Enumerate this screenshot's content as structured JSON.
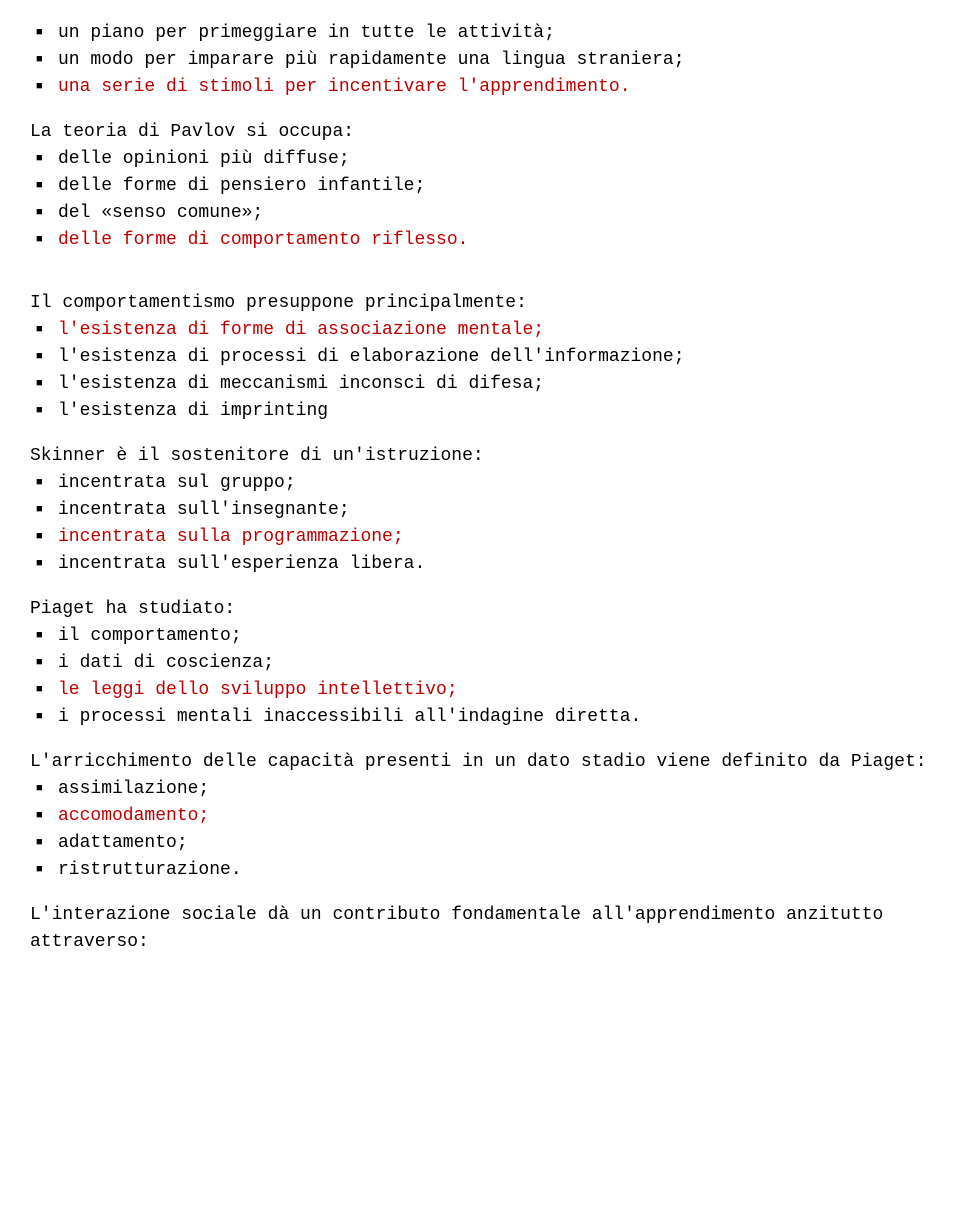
{
  "questions": [
    {
      "text": "",
      "options": [
        {
          "label": "un piano per primeggiare in tutte le attività;",
          "highlight": false
        },
        {
          "label": "un modo per imparare più rapidamente una lingua straniera;",
          "highlight": false
        },
        {
          "label": "una serie di stimoli per incentivare l'apprendimento.",
          "highlight": true
        }
      ]
    },
    {
      "text": "La teoria di Pavlov si occupa:",
      "options": [
        {
          "label": "delle opinioni più diffuse;",
          "highlight": false
        },
        {
          "label": "delle forme di pensiero infantile;",
          "highlight": false
        },
        {
          "label": "del «senso comune»;",
          "highlight": false
        },
        {
          "label": "delle forme di comportamento riflesso.",
          "highlight": true
        }
      ],
      "extraGap": true
    },
    {
      "text": "Il comportamentismo presuppone principalmente:",
      "options": [
        {
          "label": "l'esistenza di forme di associazione mentale;",
          "highlight": true
        },
        {
          "label": "l'esistenza di processi di elaborazione dell'informazione;",
          "highlight": false
        },
        {
          "label": "l'esistenza di meccanismi inconsci di difesa;",
          "highlight": false
        },
        {
          "label": "l'esistenza di imprinting",
          "highlight": false
        }
      ]
    },
    {
      "text": "Skinner è il sostenitore di un'istruzione:",
      "options": [
        {
          "label": "incentrata sul gruppo;",
          "highlight": false
        },
        {
          "label": "incentrata sull'insegnante;",
          "highlight": false
        },
        {
          "label": "incentrata sulla programmazione;",
          "highlight": true
        },
        {
          "label": "incentrata sull'esperienza libera.",
          "highlight": false
        }
      ]
    },
    {
      "text": "Piaget ha studiato:",
      "options": [
        {
          "label": "il comportamento;",
          "highlight": false
        },
        {
          "label": "i dati di coscienza;",
          "highlight": false
        },
        {
          "label": "le leggi dello sviluppo intellettivo;",
          "highlight": true
        },
        {
          "label": "i processi mentali inaccessibili all'indagine diretta.",
          "highlight": false
        }
      ]
    },
    {
      "text": "L'arricchimento delle capacità presenti in un dato stadio viene definito da Piaget:",
      "options": [
        {
          "label": "assimilazione;",
          "highlight": false
        },
        {
          "label": "accomodamento;",
          "highlight": true
        },
        {
          "label": "adattamento;",
          "highlight": false
        },
        {
          "label": "ristrutturazione.",
          "highlight": false
        }
      ]
    },
    {
      "text": "L'interazione sociale dà un contributo fondamentale all'apprendimento anzitutto attraverso:",
      "options": []
    }
  ]
}
